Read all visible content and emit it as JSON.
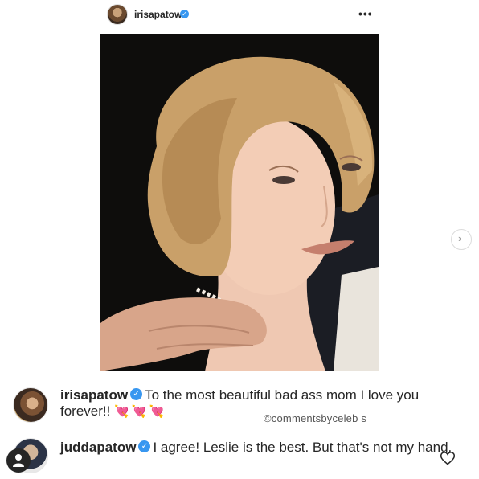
{
  "post": {
    "author": "irisapatow",
    "more_label": "•••"
  },
  "comments": [
    {
      "username": "irisapatow",
      "text": "To the most beautiful bad ass mom I love you forever!!",
      "emoji": "💘💘💘"
    },
    {
      "username": "juddapatow",
      "text": "I agree!  Leslie is the best.  But that's not my hand."
    }
  ],
  "watermark": "©commentsbyceleb s",
  "icons": {
    "verified": "verified-badge-icon",
    "next": "chevron-right-icon",
    "like": "heart-outline-icon",
    "more": "more-dots-icon",
    "account": "account-icon"
  },
  "colors": {
    "verified": "#3897f0",
    "text": "#262626",
    "hearts": "#e0479e"
  }
}
